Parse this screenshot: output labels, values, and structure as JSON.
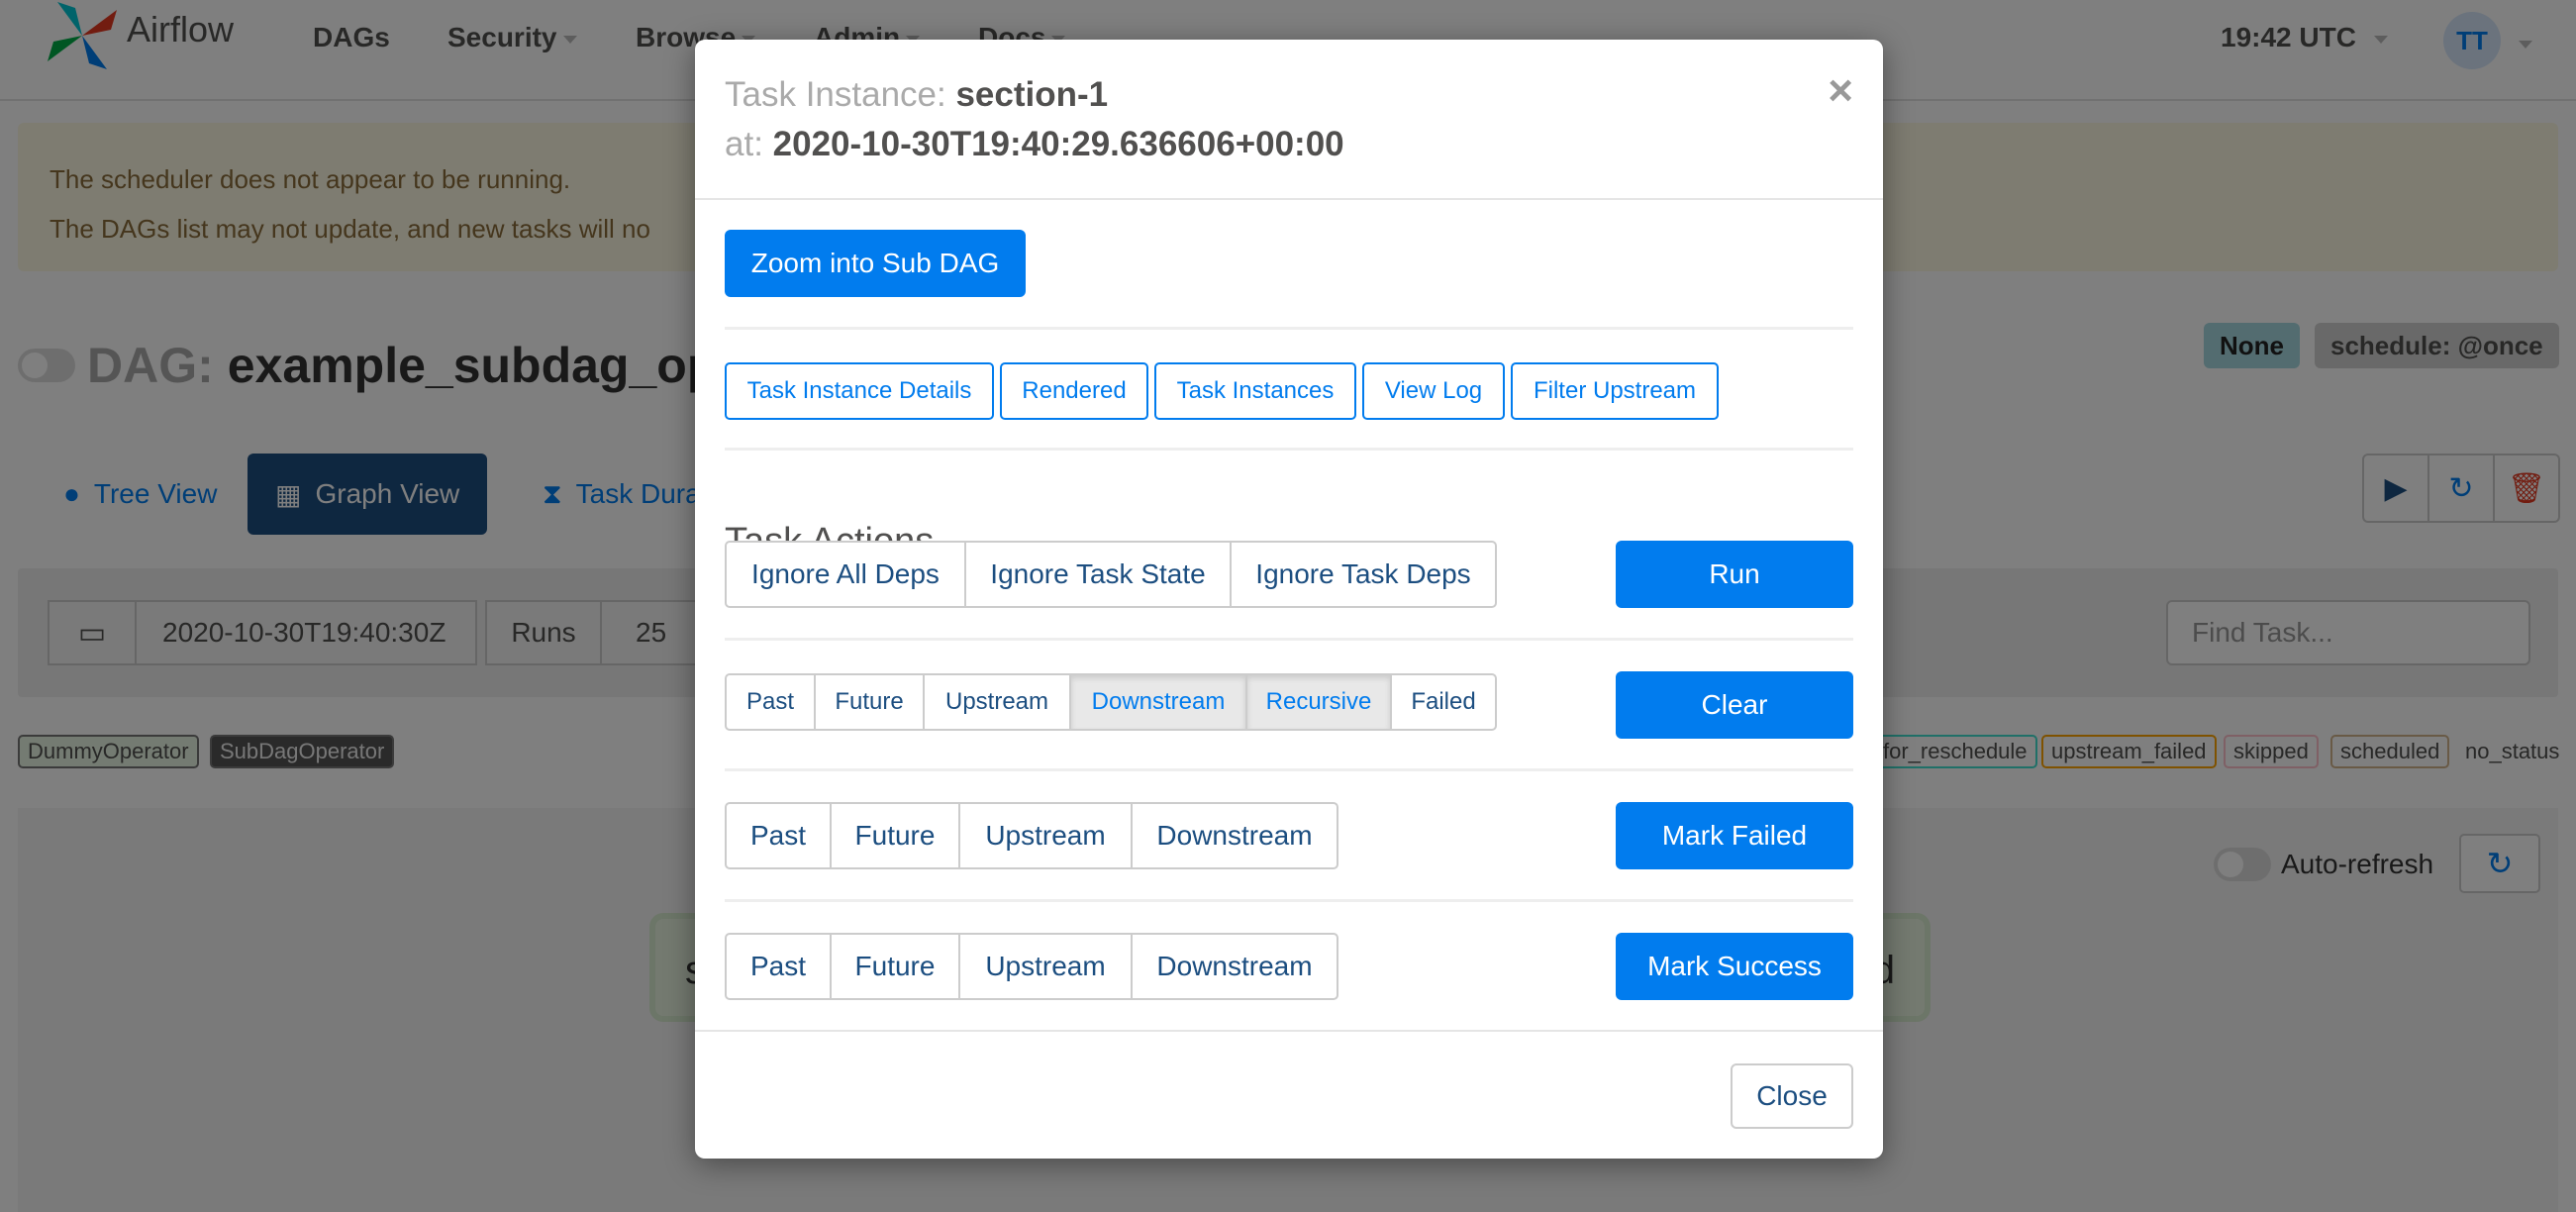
{
  "navbar": {
    "brand": "Airflow",
    "items": [
      {
        "label": "DAGs"
      },
      {
        "label": "Security"
      },
      {
        "label": "Browse"
      },
      {
        "label": "Admin"
      },
      {
        "label": "Docs"
      }
    ],
    "time": "19:42 UTC",
    "user_initials": "TT"
  },
  "alert": {
    "line1": "The scheduler does not appear to be running.",
    "line2": "The DAGs list may not update, and new tasks will no"
  },
  "dag": {
    "label": "DAG:",
    "name": "example_subdag_ope",
    "badge_none": "None",
    "badge_schedule": "schedule: @once"
  },
  "views": {
    "tree": "Tree View",
    "graph": "Graph View",
    "duration": "Task Dura"
  },
  "runbar": {
    "date": "2020-10-30T19:40:30Z",
    "runs_label": "Runs",
    "runs_value": "25",
    "find_placeholder": "Find Task..."
  },
  "legend": {
    "dummy": "DummyOperator",
    "subdag": "SubDagOperator",
    "up_for_reschedule": "for_reschedule",
    "upstream_failed": "upstream_failed",
    "skipped": "skipped",
    "scheduled": "scheduled",
    "no_status": "no_status"
  },
  "graph": {
    "autorefresh": "Auto-refresh",
    "node_left": "s",
    "node_right": "d"
  },
  "modal": {
    "title_key": "Task Instance:",
    "title_value": "section-1",
    "at_key": "at:",
    "at_value": "2020-10-30T19:40:29.636606+00:00",
    "zoom_button": "Zoom into Sub DAG",
    "links": [
      "Task Instance Details",
      "Rendered",
      "Task Instances",
      "View Log",
      "Filter Upstream"
    ],
    "actions_title": "Task Actions",
    "run_options": [
      "Ignore All Deps",
      "Ignore Task State",
      "Ignore Task Deps"
    ],
    "run_button": "Run",
    "clear_options": [
      "Past",
      "Future",
      "Upstream",
      "Downstream",
      "Recursive",
      "Failed"
    ],
    "clear_button": "Clear",
    "failed_options": [
      "Past",
      "Future",
      "Upstream",
      "Downstream"
    ],
    "failed_button": "Mark Failed",
    "success_options": [
      "Past",
      "Future",
      "Upstream",
      "Downstream"
    ],
    "success_button": "Mark Success",
    "close_button": "Close",
    "close_x": "×"
  },
  "colors": {
    "primary": "#017cee",
    "navy": "#1c4e80",
    "badge_none": "#a6d8e0",
    "badge_schedule": "#d2d2d2"
  }
}
